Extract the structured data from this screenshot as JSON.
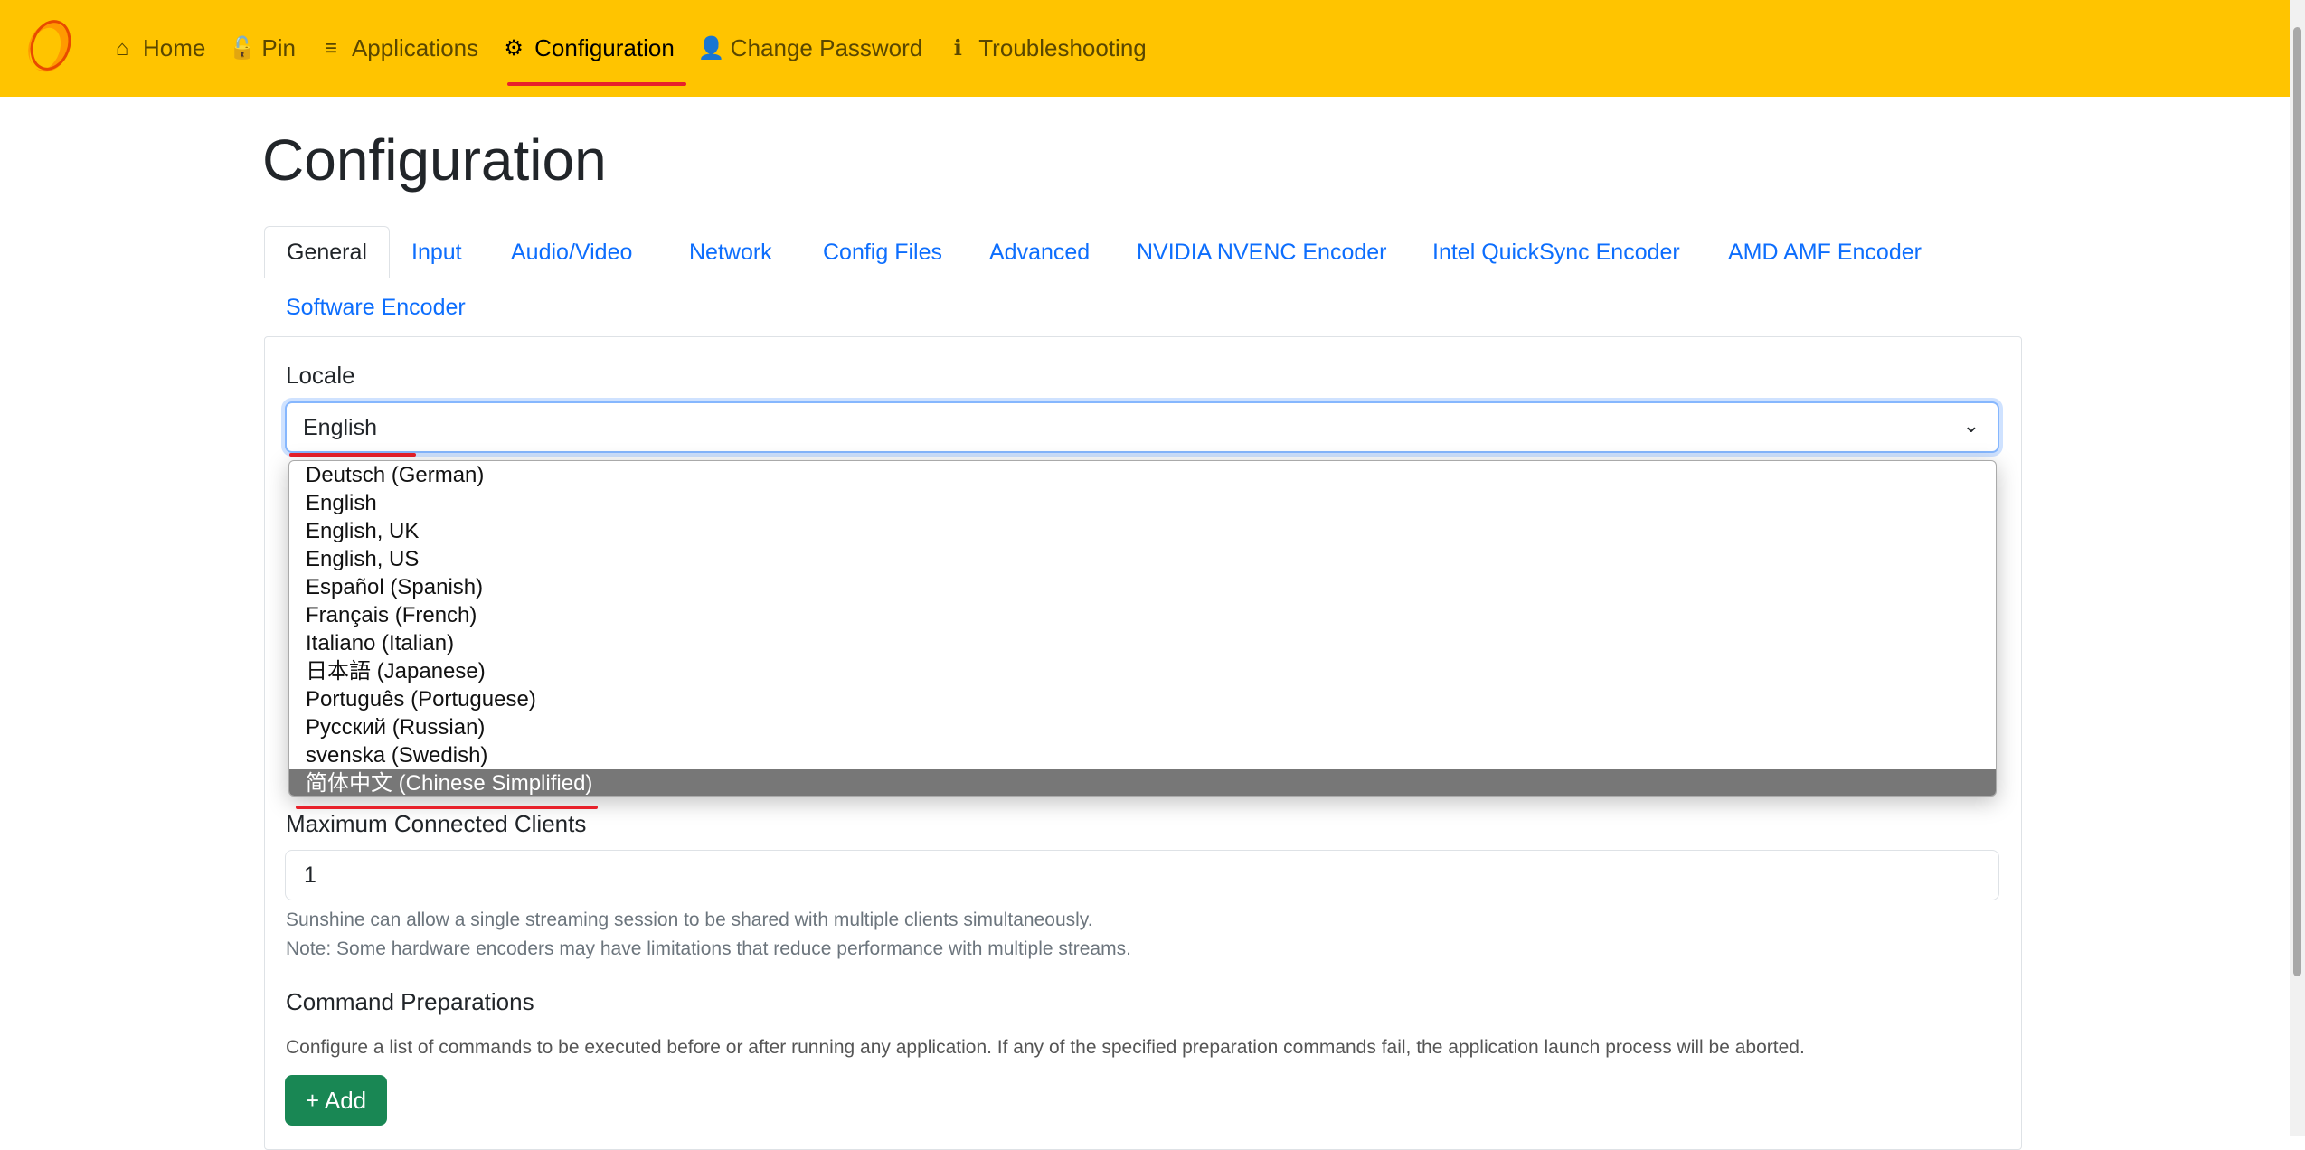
{
  "nav": {
    "items": [
      {
        "label": "Home",
        "icon": "home-icon",
        "glyph": "⌂"
      },
      {
        "label": "Pin",
        "icon": "unlock-icon",
        "glyph": "🔓"
      },
      {
        "label": "Applications",
        "icon": "list-icon",
        "glyph": "≡"
      },
      {
        "label": "Configuration",
        "icon": "gear-icon",
        "glyph": "⚙"
      },
      {
        "label": "Change Password",
        "icon": "user-lock-icon",
        "glyph": "👤"
      },
      {
        "label": "Troubleshooting",
        "icon": "info-icon",
        "glyph": "ℹ"
      }
    ],
    "active": "Configuration",
    "bg": "#ffc400"
  },
  "page": {
    "title": "Configuration"
  },
  "tabs": [
    "General",
    "Input",
    "Audio/Video",
    "Network",
    "Config Files",
    "Advanced",
    "NVIDIA NVENC Encoder",
    "Intel QuickSync Encoder",
    "AMD AMF Encoder",
    "Software Encoder"
  ],
  "locale": {
    "label": "Locale",
    "value": "English",
    "options": [
      "Deutsch (German)",
      "English",
      "English, UK",
      "English, US",
      "Español (Spanish)",
      "Français (French)",
      "Italiano (Italian)",
      "日本語 (Japanese)",
      "Português (Portuguese)",
      "Русский (Russian)",
      "svenska (Swedish)",
      "简体中文 (Chinese Simplified)"
    ],
    "highlighted": "简体中文 (Chinese Simplified)"
  },
  "clients": {
    "label": "Maximum Connected Clients",
    "value": "1",
    "help1": "Sunshine can allow a single streaming session to be shared with multiple clients simultaneously.",
    "help2": "Note: Some hardware encoders may have limitations that reduce performance with multiple streams."
  },
  "commands": {
    "label": "Command Preparations",
    "desc": "Configure a list of commands to be executed before or after running any application. If any of the specified preparation commands fail, the application launch process will be aborted.",
    "add": "+ Add"
  }
}
